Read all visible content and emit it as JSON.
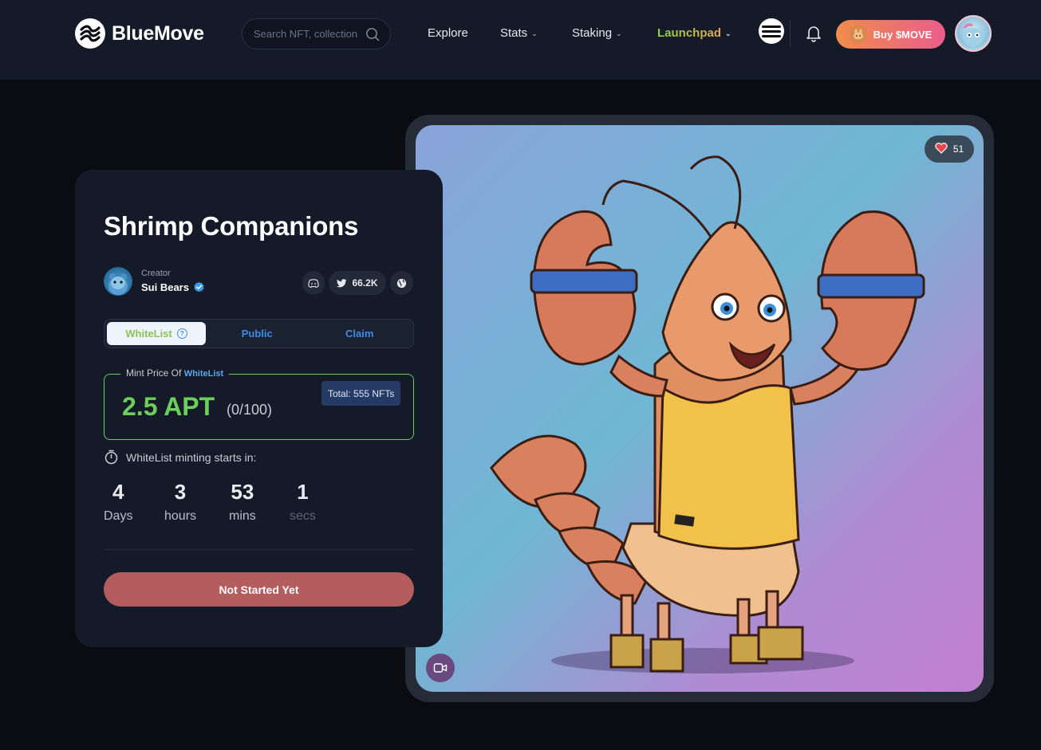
{
  "header": {
    "brand": "BlueMove",
    "search_placeholder": "Search NFT, collection",
    "nav": [
      {
        "label": "Explore"
      },
      {
        "label": "Stats"
      },
      {
        "label": "Staking"
      },
      {
        "label": "Launchpad"
      }
    ],
    "buy_label": "Buy $MOVE"
  },
  "collection": {
    "title": "Shrimp Companions",
    "creator_label": "Creator",
    "creator_name": "Sui Bears",
    "twitter_followers": "66.2K"
  },
  "tabs": [
    {
      "label": "WhiteList",
      "active": true
    },
    {
      "label": "Public",
      "active": false
    },
    {
      "label": "Claim",
      "active": false
    }
  ],
  "mint": {
    "legend_prefix": "Mint Price Of",
    "legend_phase": "WhiteList",
    "price": "2.5 APT",
    "count": "(0/100)",
    "total": "Total: 555 NFTs"
  },
  "countdown": {
    "label": "WhiteList minting starts in:",
    "units": [
      {
        "value": "4",
        "unit": "Days"
      },
      {
        "value": "3",
        "unit": "hours"
      },
      {
        "value": "53",
        "unit": "mins"
      },
      {
        "value": "1",
        "unit": "secs"
      }
    ]
  },
  "cta_label": "Not Started Yet",
  "artwork": {
    "likes": "51"
  },
  "colors": {
    "accent_green": "#6ccf5b",
    "accent_blue": "#3f8ce8",
    "cta": "#b45d5f",
    "buy_gradient_start": "#f08c4c",
    "buy_gradient_end": "#ea5d8c"
  }
}
